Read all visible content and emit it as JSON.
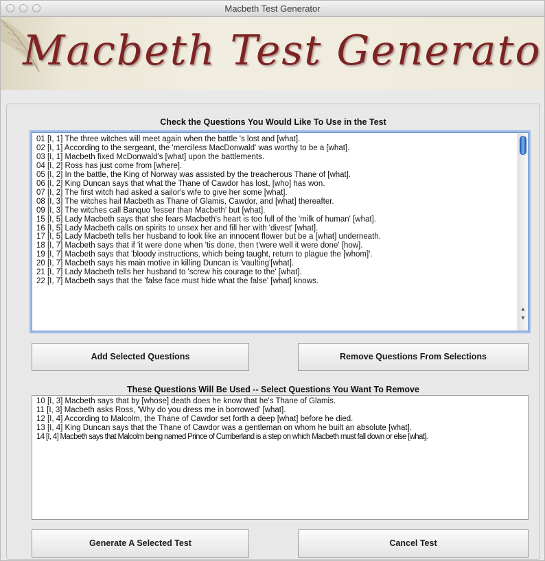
{
  "window": {
    "title": "Macbeth Test Generator"
  },
  "banner": {
    "logo_text": "Macbeth Test Generator"
  },
  "available": {
    "heading": "Check the Questions You Would Like To Use in the Test",
    "items": [
      "01 [I, 1] The three witches  will  meet  again  when  the  battle 's lost and [what].",
      "02 [I, 1] According to the sergeant, the 'merciless MacDonwald' was worthy to be a [what].",
      "03 [I, 1] Macbeth fixed McDonwald's [what] upon the battlements.",
      "04 [I, 2] Ross has just come from [where].",
      "05 [I, 2] In the battle, the King of Norway was assisted by the treacherous Thane of [what].",
      "06 [I, 2] King Duncan says that what the Thane of Cawdor has lost, [who] has won.",
      "07 [I, 2] The first witch had asked a sailor's wife to give her some [what].",
      "08 [I, 3] The witches hail Macbeth as Thane of Glamis, Cawdor, and [what] thereafter.",
      "09 [I, 3] The witches call Banquo 'lesser than Macbeth' but [what].",
      "15 [I, 5] Lady Macbeth says that she fears Macbeth's heart is too full of the 'milk of human' [what].",
      "16 [I, 5] Lady Macbeth calls on spirits to unsex her and fill her with 'divest' [what].",
      "17 [I, 5] Lady Macbeth tells her husband to look like an innocent flower but be a [what] underneath.",
      "18 [I, 7] Macbeth says that if 'it were done when 'tis done, then t'were well it were done' [how].",
      "19 [I, 7] Macbeth says that 'bloody instructions, which being taught, return to plague the [whom]'.",
      "20 [I, 7] Macbeth says his main motive in killing Duncan is 'vaulting'[what].",
      "21 [I, 7] Lady Macbeth tells her husband to 'screw his courage to the' [what].",
      "22 [I, 7] Macbeth says that the 'false face must hide what the false' [what] knows."
    ]
  },
  "buttons": {
    "add": "Add Selected Questions",
    "remove": "Remove Questions From Selections",
    "generate": "Generate A Selected Test",
    "cancel": "Cancel Test"
  },
  "selected": {
    "heading": "These Questions Will Be Used -- Select Questions You Want To Remove",
    "items": [
      "10 [I, 3] Macbeth says that by [whose] death does he know that he's Thane of Glamis.",
      "11 [I, 3] Macbeth asks Ross, 'Why do you dress me in borrowed' [what].",
      "12 [I, 4] According to Malcolm, the Thane of Cawdor set forth a deep [what] before he died.",
      "13 [I, 4] King Duncan says that the Thane of Cawdor was a gentleman on whom he built an absolute [what].",
      "14 [I, 4] Macbeth says that Malcolm being named Prince of Cumberland is a step on which Macbeth must fall down or else [what]."
    ]
  }
}
